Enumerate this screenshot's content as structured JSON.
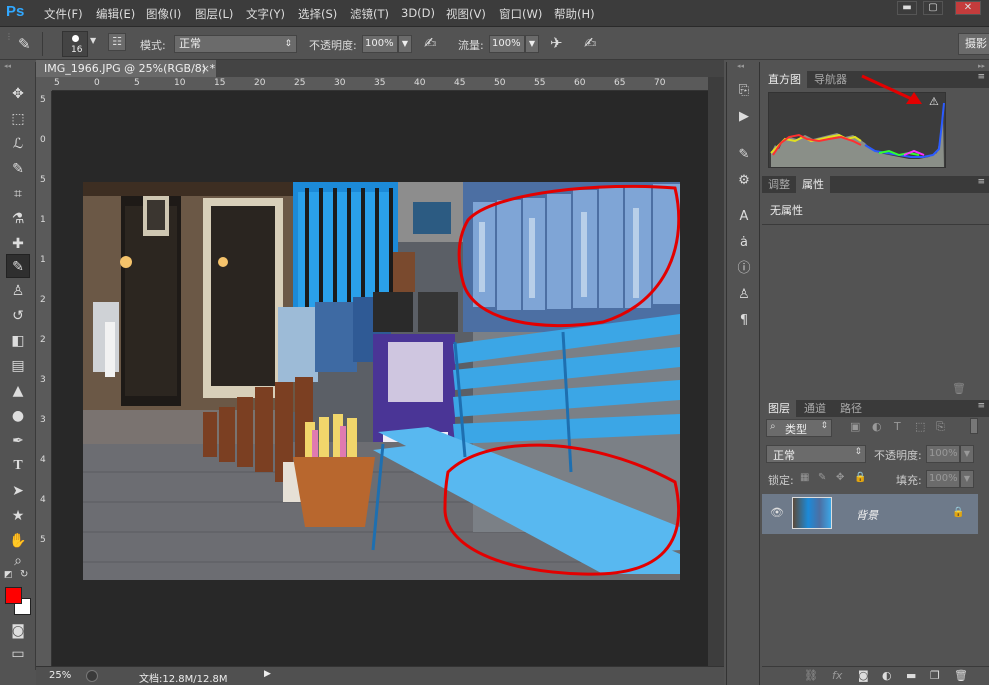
{
  "app": {
    "logo": "Ps"
  },
  "menu": [
    "文件(F)",
    "编辑(E)",
    "图像(I)",
    "图层(L)",
    "文字(Y)",
    "选择(S)",
    "滤镜(T)",
    "3D(D)",
    "视图(V)",
    "窗口(W)",
    "帮助(H)"
  ],
  "window_buttons": {
    "minimize": "▬",
    "restore": "▢",
    "close": "✕"
  },
  "options": {
    "brush_size": "16",
    "mode_label": "模式:",
    "mode_value": "正常",
    "opacity_label": "不透明度:",
    "opacity_value": "100%",
    "flow_label": "流量:",
    "flow_value": "100%",
    "workspace": "摄影"
  },
  "document": {
    "tab_title": "IMG_1966.JPG @ 25%(RGB/8) *",
    "close": "×",
    "zoom": "25%",
    "doc_info": "文档:12.8M/12.8M"
  },
  "ruler": {
    "top": [
      "5",
      "0",
      "5",
      "10",
      "15",
      "20",
      "25",
      "30",
      "35",
      "40",
      "45",
      "50",
      "55",
      "60",
      "65",
      "70"
    ],
    "left": [
      "5",
      "0",
      "5",
      "1",
      "1",
      "2",
      "2",
      "3",
      "3",
      "4",
      "4",
      "5"
    ]
  },
  "histogram_panel": {
    "tabs": [
      "直方图",
      "导航器"
    ],
    "warning": "⚠"
  },
  "properties_panel": {
    "tabs": [
      "调整",
      "属性"
    ],
    "content": "无属性"
  },
  "layers_panel": {
    "tabs": [
      "图层",
      "通道",
      "路径"
    ],
    "filter_label": "类型",
    "blend_mode": "正常",
    "opacity_label": "不透明度:",
    "opacity_value": "100%",
    "lock_label": "锁定:",
    "fill_label": "填充:",
    "fill_value": "100%",
    "layers": [
      {
        "name": "背景"
      }
    ]
  },
  "colors": {
    "foreground": "#ff0000",
    "background": "#ffffff",
    "annotation": "#e30000"
  }
}
